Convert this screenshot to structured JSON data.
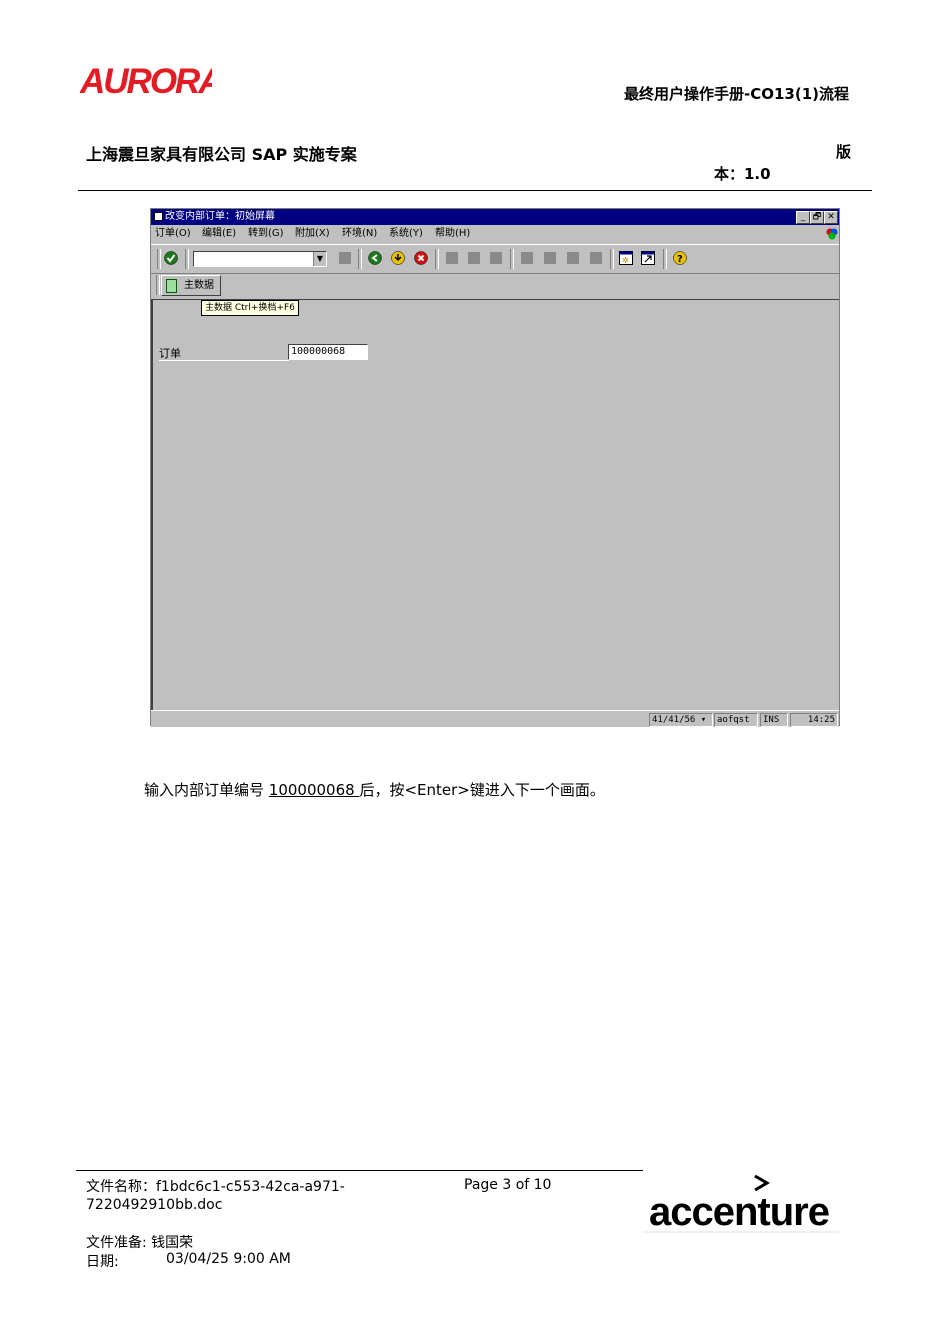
{
  "header": {
    "logo_text": "AURORA",
    "doc_title": "最终用户操作手册-CO13(1)流程",
    "company": "上海震旦家具有限公司 SAP 实施专案",
    "version_label_a": "版",
    "version_label_b": "本：1.0"
  },
  "sap_window": {
    "title": "改变内部订单：初始屏幕",
    "menu": [
      "订单(O)",
      "编辑(E)",
      "转到(G)",
      "附加(X)",
      "环境(N)",
      "系统(Y)",
      "帮助(H)"
    ],
    "window_controls": [
      "_",
      "🗗",
      "✕"
    ],
    "app_button_label": "主数据",
    "tooltip": "主数据    Ctrl+换档+F6",
    "field_label": "订单",
    "field_value": "100000068",
    "status": {
      "session": "41/41/56",
      "user": "aofqst",
      "mode": "INS",
      "time": "14:25"
    }
  },
  "instruction": {
    "before": "输入内部订单编号 ",
    "order": "100000068 ",
    "after": "后，按<Enter>键进入下一个画面。"
  },
  "footer": {
    "file_name": "文件名称：f1bdc6c1-c553-42ca-a971-7220492910bb.doc",
    "page": "Page 3 of 10",
    "preparer": "文件准备: 钱国荣",
    "date_label": "日期:",
    "date_value": "03/04/25 9:00 AM",
    "logo_text": "accenture"
  },
  "colors": {
    "aurora_red": "#e31b23",
    "sap_titlebar": "#000080",
    "sap_gray": "#c0c0c0"
  }
}
